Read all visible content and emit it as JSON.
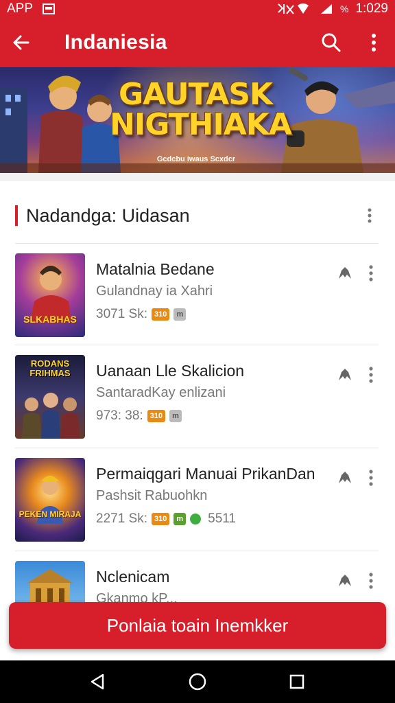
{
  "status_bar": {
    "app_label": "APP",
    "time": "1:029",
    "battery_text": "%"
  },
  "app_bar": {
    "title": "Indaniesia",
    "icons": [
      "back-arrow-icon",
      "search-icon",
      "more-vert-icon"
    ]
  },
  "banner": {
    "title": "GAUTASK NIGTHIAKA",
    "subtitle": "Gcdcbu iwaus Scxdcr"
  },
  "section": {
    "title": "Nadandga: Uidasan"
  },
  "items": [
    {
      "title": "Matalnia Bedane",
      "subtitle": "Gulandnay ia Xahri",
      "meta": "3071 Sk:",
      "tags": [
        "310",
        "m"
      ]
    },
    {
      "title": "Uanaan Lle Skalicion",
      "subtitle": "SantaradKay enlizani",
      "meta": "973: 38:",
      "tags": [
        "310",
        "m"
      ]
    },
    {
      "title": "Permaiqgari Manuai PrikanDan",
      "subtitle": "Pashsit Rabuohkn",
      "meta": "2271 Sk:",
      "tags": [
        "310",
        "m"
      ],
      "extra": "5511"
    },
    {
      "title": "Nclenicam",
      "subtitle": "Gkanmo kP...",
      "meta": "",
      "tags": []
    }
  ],
  "thumb_texts": [
    "SLKABHAS",
    "RODANS FRIHMAS",
    "PEKEN MIRAJA"
  ],
  "cta": {
    "label": "Ponlaia toain Inemkker"
  },
  "colors": {
    "primary": "#d71f2b",
    "tag_orange": "#e98a12",
    "tag_green": "#5aa02c"
  }
}
